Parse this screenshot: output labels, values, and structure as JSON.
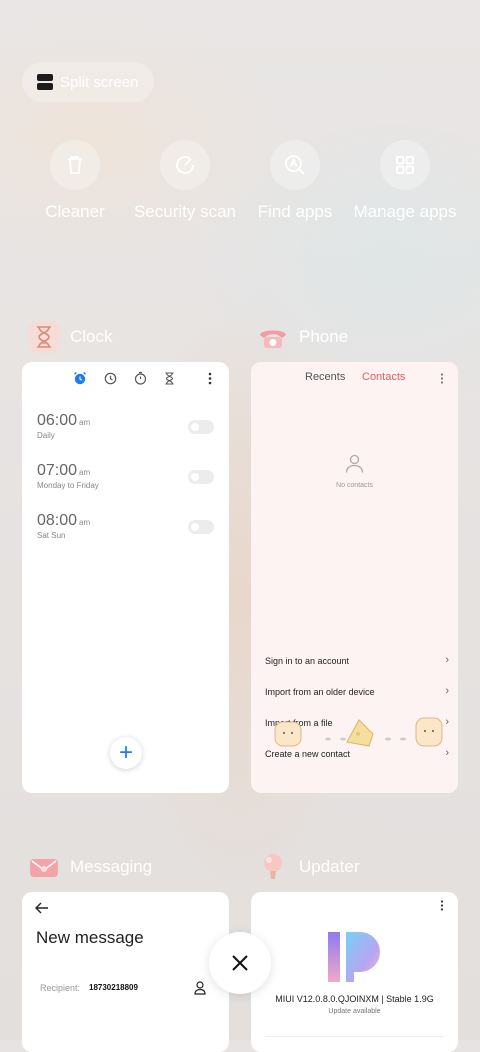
{
  "split_screen": {
    "label": "Split screen"
  },
  "actions": [
    {
      "label": "Cleaner",
      "icon": "trash-icon"
    },
    {
      "label": "Security scan",
      "icon": "security-scan-icon"
    },
    {
      "label": "Find apps",
      "icon": "find-apps-icon"
    },
    {
      "label": "Manage apps",
      "icon": "grid-icon"
    }
  ],
  "apps": {
    "clock": {
      "name": "Clock",
      "alarms": [
        {
          "time": "06:00",
          "ampm": "am",
          "repeat": "Daily"
        },
        {
          "time": "07:00",
          "ampm": "am",
          "repeat": "Monday to Friday"
        },
        {
          "time": "08:00",
          "ampm": "am",
          "repeat": "Sat Sun"
        }
      ],
      "accent": "#1e7cf2"
    },
    "phone": {
      "name": "Phone",
      "tabs": {
        "recents": "Recents",
        "contacts": "Contacts"
      },
      "empty": "No contacts",
      "options": [
        "Sign in to an account",
        "Import from an older device",
        "Import from a file",
        "Create a new contact"
      ],
      "accent": "#f0595a"
    },
    "messaging": {
      "name": "Messaging",
      "title": "New message",
      "recipient_label": "Recipient:",
      "recipient_value": "18730218809"
    },
    "updater": {
      "name": "Updater",
      "version": "MIUI V12.0.8.0.QJOINXM | Stable 1.9G",
      "status": "Update available"
    }
  }
}
